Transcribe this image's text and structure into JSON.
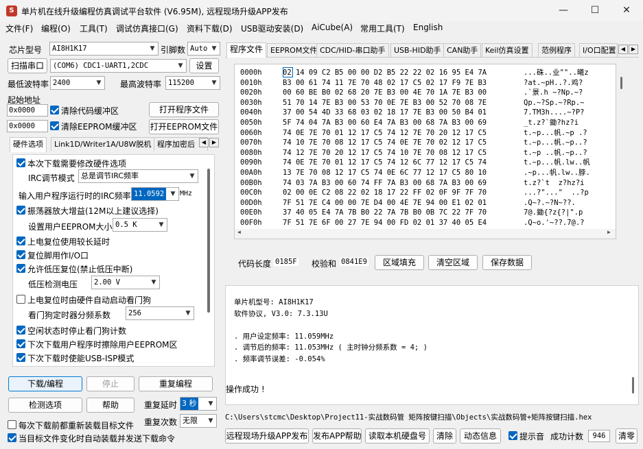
{
  "window": {
    "title": "单片机在线升级编程仿真调试平台软件 (V6.95M), 远程现场升级APP发布",
    "icon": "app-logo-icon",
    "controls": {
      "minimize": "—",
      "maximize": "☐",
      "close": "✕"
    }
  },
  "menu": [
    "文件(F)",
    "编程(O)",
    "工具(T)",
    "调试仿真接口(G)",
    "资料下载(D)",
    "USB驱动安装(D)",
    "AiCube(A)",
    "常用工具(T)",
    "English"
  ],
  "left": {
    "chip_label": "芯片型号",
    "chip_value": "AI8H1K17",
    "pins_label": "引脚数",
    "pins_value": "Auto",
    "scan_button": "扫描串口",
    "com_value": "(COM6) CDC1-UART1,2CDC",
    "settings_button": "设置",
    "min_baud_label": "最低波特率",
    "min_baud_value": "2400",
    "max_baud_label": "最高波特率",
    "max_baud_value": "115200",
    "start_addr_label": "起始地址",
    "code_addr": "0x0000",
    "clear_code_label": "清除代码缓冲区",
    "open_program_button": "打开程序文件",
    "eeprom_addr": "0x0000",
    "clear_eeprom_label": "清除EEPROM缓冲区",
    "open_eeprom_button": "打开EEPROM文件",
    "tabs": [
      "硬件选项",
      "Link1D/Writer1A/U8W脱机",
      "程序加密后"
    ],
    "hw_options": {
      "opt1": "本次下载需要修改硬件选项",
      "irc_mode_label": "IRC调节模式",
      "irc_mode_value": "总是调节IRC频率",
      "irc_freq_label": "输入用户程序运行时的IRC频率",
      "irc_freq_value": "11.0592",
      "irc_freq_unit": "MHz",
      "opt_amp": "振荡器放大增益(12M以上建议选择)",
      "eeprom_size_label": "设置用户EEPROM大小",
      "eeprom_size_value": "0.5 K",
      "opt_reset_delay": "上电复位使用较长延时",
      "opt_reset_io": "复位脚用作I/O口",
      "opt_lvr": "允许低压复位(禁止低压中断)",
      "lv_label": "低压检测电压",
      "lv_value": "2.00 V",
      "opt_wdt": "上电复位时由硬件自动启动看门狗",
      "wdt_div_label": "看门狗定时器分频系数",
      "wdt_div_value": "256",
      "opt_idle_wdt": "空闲状态时停止看门狗计数",
      "opt_erase_eeprom": "下次下载用户程序时擦除用户EEPROM区",
      "opt_usb_isp": "下次下载时使能USB-ISP模式"
    },
    "download_button": "下载/编程",
    "stop_button": "停止",
    "reprogram_button": "重复编程",
    "check_button": "检测选项",
    "help_button": "帮助",
    "repeat_delay_label": "重复延时",
    "repeat_delay_value": "3 秒",
    "repeat_count_label": "重复次数",
    "repeat_count_value": "无限",
    "reload_label": "每次下载前都重新装载目标文件",
    "autoload_label": "当目标文件变化时自动装载并发送下载命令"
  },
  "right": {
    "tabs": [
      "程序文件",
      "EEPROM文件",
      "CDC/HID-串口助手",
      "USB-HID助手",
      "CAN助手",
      "Keil仿真设置",
      "范例程序",
      "I/O口配置"
    ],
    "hex_rows": [
      {
        "addr": "0000h",
        "bytes": "02 14 09 C2 B5 00 00 D2 B5 22 22 02 16 95 E4 7A",
        "ascii": "...硃..业\"\"..曦z"
      },
      {
        "addr": "0010h",
        "bytes": "B3 00 61 74 11 7E 70 48 02 17 C5 02 17 F9 7E B3",
        "ascii": "?at.~pH..?.鸡?"
      },
      {
        "addr": "0020h",
        "bytes": "00 60 BE B0 02 68 20 7E B3 00 4E 70 1A 7E B3 00",
        "ascii": ".`景.h ~?Np.~?"
      },
      {
        "addr": "0030h",
        "bytes": "51 70 14 7E B3 00 53 70 0E 7E B3 00 52 70 08 7E",
        "ascii": "Qp.~?Sp.~?Rp.~"
      },
      {
        "addr": "0040h",
        "bytes": "37 00 54 4D 33 68 03 02 18 17 7E B3 00 50 B4 01",
        "ascii": "7.TM3h....~?P?"
      },
      {
        "addr": "0050h",
        "bytes": "5F 74 04 7A B3 00 60 E4 7A B3 00 68 7A B3 00 69",
        "ascii": "_t.z?`鋤?hz?i"
      },
      {
        "addr": "0060h",
        "bytes": "74 0E 7E 70 01 12 17 C5 74 12 7E 70 20 12 17 C5",
        "ascii": "t.~p...帆.~p .?"
      },
      {
        "addr": "0070h",
        "bytes": "74 10 7E 70 08 12 17 C5 74 0E 7E 70 02 12 17 C5",
        "ascii": "t.~p...帆.~p..?"
      },
      {
        "addr": "0080h",
        "bytes": "74 12 7E 70 20 12 17 C5 74 10 7E 70 08 12 17 C5",
        "ascii": "t.~p ..帆.~p..?"
      },
      {
        "addr": "0090h",
        "bytes": "74 0E 7E 70 01 12 17 C5 74 12 6C 77 12 17 C5 74",
        "ascii": "t.~p...帆.lw..帆"
      },
      {
        "addr": "00A0h",
        "bytes": "13 7E 70 08 12 17 C5 74 0E 6C 77 12 17 C5 80 10",
        "ascii": ".~p...帆.lw..脖."
      },
      {
        "addr": "00B0h",
        "bytes": "74 03 7A B3 00 60 74 FF 7A B3 00 68 7A B3 00 69",
        "ascii": "t.z?`t  z?hz?i"
      },
      {
        "addr": "00C0h",
        "bytes": "02 00 0E C2 08 22 02 18 17 22 FF 02 0F 9F 7F 70",
        "ascii": "...?\"...\"  ..?p"
      },
      {
        "addr": "00D0h",
        "bytes": "7F 51 7E C4 00 00 7E D4 00 4E 7E 94 00 E1 02 01",
        "ascii": ".Q~?.~?N~??."
      },
      {
        "addr": "00E0h",
        "bytes": "37 40 05 E4 7A 7B B0 22 7A 7B B0 0B 7C 22 7F 70",
        "ascii": "7@.鋤{?z{?|\".p"
      },
      {
        "addr": "00F0h",
        "bytes": "7F 51 7E 6F 00 27 7E 94 00 FD 02 01 37 40 05 E4",
        "ascii": ".Q~o.'~??.7@.?"
      }
    ],
    "code_len_label": "代码长度",
    "code_len_value": "0185F",
    "checksum_label": "校验和",
    "checksum_value": "0841E9",
    "fill_button": "区域填充",
    "clear_button": "清空区域",
    "save_button": "保存数据",
    "info_lines": [
      "单片机型号: AI8H1K17",
      "软件协议, V3.0: 7.3.13U",
      "",
      ". 用户设定频率: 11.059MHz",
      ". 调节后的频率: 11.053MHz ( 主时钟分频系数 = 4; )",
      ". 频率调节误差: -0.054%"
    ],
    "success_text": "操作成功 !",
    "file_path": "C:\\Users\\stcmc\\Desktop\\Project11-实战数码管 矩阵按键扫描\\Objects\\实战数码管+矩阵按键扫描.hex",
    "publish_button": "远程现场升级APP发布",
    "help_app_button": "发布APP帮助",
    "read_disk_button": "读取本机硬盘号",
    "clear_btn2": "清除",
    "dynamic_info_button": "动态信息",
    "beep_label": "提示音",
    "success_count_label": "成功计数",
    "success_count_value": "946",
    "reset_count_button": "清零"
  }
}
